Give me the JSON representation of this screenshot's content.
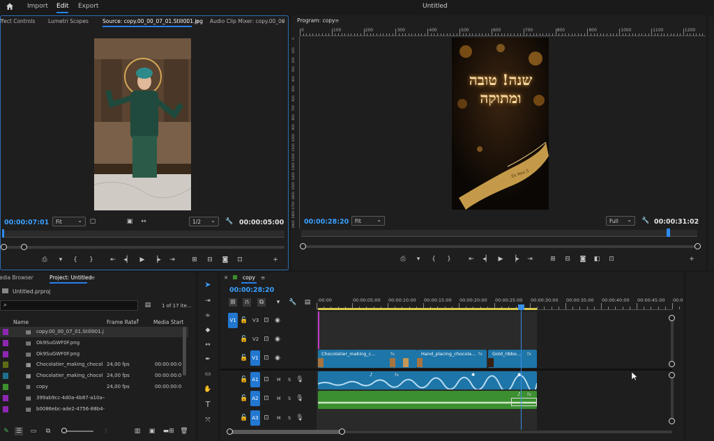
{
  "topbar": {
    "home_icon": "home-icon",
    "tabs": [
      "Import",
      "Edit",
      "Export"
    ],
    "active_tab": "Edit",
    "title": "Untitled"
  },
  "source_panel": {
    "tabs": [
      "ffect Controls",
      "Lumetri Scopes",
      "Source: copy.00_00_07_01.Still001.jpg",
      "Audio Clip Mixer: copy.00_00"
    ],
    "active_tab": "Source: copy.00_00_07_01.Still001.jpg",
    "timecode": "00:00:07:01",
    "zoom": "Fit",
    "resolution": "1/2",
    "duration": "00:00:05:00"
  },
  "program_panel": {
    "tab": "Program: copy",
    "timecode": "00:00:28:20",
    "zoom": "Fit",
    "resolution": "Full",
    "duration": "00:00:31:02",
    "ruler_ticks": [
      "0",
      "100",
      "200",
      "300",
      "400",
      "500",
      "600",
      "700",
      "800",
      "900",
      "1000",
      "1100",
      "1200"
    ],
    "vruler_ticks": [
      "0",
      "100",
      "200",
      "300",
      "400",
      "500",
      "600",
      "700",
      "800",
      "900",
      "1000",
      "1100",
      "1200",
      "1300",
      "1400",
      "1500",
      "1600",
      "1700",
      "1800",
      "1900"
    ],
    "overlay_text": "שנה! טובה ומתוקה",
    "ribbon_text": "Ek Nes S"
  },
  "project_panel": {
    "tabs": [
      "edia Browser",
      "Project: Untitled"
    ],
    "active_tab": "Project: Untitled",
    "project_file": "Untitled.prproj",
    "items_count": "1 of 17 ite...",
    "columns": [
      "Name",
      "Frame Rate",
      "Media Start"
    ],
    "rows": [
      {
        "name": "copy.00_00_07_01.Still001.j",
        "frame_rate": "",
        "media_start": "",
        "color": "#8d27b2",
        "icon": "image-icon"
      },
      {
        "name": "Ok9SuGWF0F.png",
        "frame_rate": "",
        "media_start": "",
        "color": "#8d27b2",
        "icon": "image-icon"
      },
      {
        "name": "Ok9SuGWF0F.png",
        "frame_rate": "",
        "media_start": "",
        "color": "#8d27b2",
        "icon": "image-icon"
      },
      {
        "name": "Chocolatier_making_chocol",
        "frame_rate": "24,00 fps",
        "media_start": "00:00:00:0",
        "color": "#5f6b14",
        "icon": "av-clip-icon"
      },
      {
        "name": "Chocolatier_making_chocol",
        "frame_rate": "24,00 fps",
        "media_start": "00:00:00:0",
        "color": "#1f6f8e",
        "icon": "video-clip-icon"
      },
      {
        "name": "copy",
        "frame_rate": "24,00 fps",
        "media_start": "00:00:00:0",
        "color": "#3c8e2c",
        "icon": "sequence-icon"
      },
      {
        "name": "399ab9cc-4d0a-4b87-a10a-e",
        "frame_rate": "",
        "media_start": "",
        "color": "#8d27b2",
        "icon": "image-icon"
      },
      {
        "name": "b0086ebc-ade2-4756-88b4-f",
        "frame_rate": "",
        "media_start": "",
        "color": "#8d27b2",
        "icon": "image-icon"
      }
    ]
  },
  "timeline": {
    "tab": "copy",
    "timecode": "00:00:28:20",
    "ruler_labels": [
      ":00:00",
      "00:00:05:00",
      "00:00:10:00",
      "00:00:15:00",
      "00:00:20:00",
      "00:00:25:00",
      "00:00:30:00",
      "00:00:35:00",
      "00:00:40:00",
      "00:00:45:00",
      "00:00"
    ],
    "tracks": {
      "video": [
        "V3",
        "V2",
        "V1"
      ],
      "audio": [
        "A1",
        "A2",
        "A3"
      ],
      "source_patch_v": "V1",
      "source_patch_a": "A1"
    },
    "clips": {
      "v1_1": "Chocolatier_making_c...",
      "v1_2": "Hand_placing_chocola...",
      "v1_3": "Gold_ribbo...",
      "fx": "fx"
    },
    "audio_btn_m": "M",
    "audio_btn_s": "S"
  }
}
